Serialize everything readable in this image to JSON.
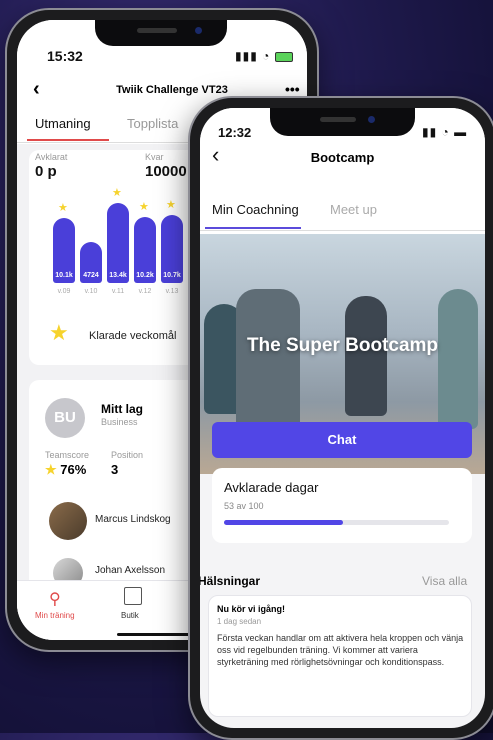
{
  "back_phone": {
    "time": "15:32",
    "title": "Twiik Challenge VT23",
    "tabs": [
      "Utmaning",
      "Topplista"
    ],
    "stats": {
      "done_label": "Avklarat",
      "done_value": "0 p",
      "left_label": "Kvar",
      "left_value": "10000 p"
    },
    "bars": [
      {
        "label": "v.09",
        "value": "10.1k",
        "star": true
      },
      {
        "label": "v.10",
        "value": "4724",
        "star": false
      },
      {
        "label": "v.11",
        "value": "13.4k",
        "star": true
      },
      {
        "label": "v.12",
        "value": "10.2k",
        "star": true
      },
      {
        "label": "v.13",
        "value": "10.7k",
        "star": true
      }
    ],
    "weekly_goals": "Klarade veckomål",
    "team": {
      "initials": "BU",
      "name": "Mitt lag",
      "type": "Business",
      "score_label": "Teamscore",
      "score": "76%",
      "position_label": "Position",
      "position": "3"
    },
    "members": [
      "Marcus Lindskog",
      "Johan Axelsson"
    ],
    "bottom_nav": [
      "Min träning",
      "Butik"
    ]
  },
  "front_phone": {
    "time": "12:32",
    "title": "Bootcamp",
    "tabs": [
      "Min Coachning",
      "Meet up"
    ],
    "hero_title": "The Super Bootcamp",
    "chat_label": "Chat",
    "progress": {
      "title": "Avklarade dagar",
      "subtitle": "53 av 100",
      "done": 53,
      "total": 100
    },
    "greetings": {
      "header": "Hälsningar",
      "see_all": "Visa alla",
      "item_title": "Nu kör vi igång!",
      "item_time": "1 dag sedan",
      "item_body": "Första veckan handlar om att aktivera hela kroppen och vänja oss vid regelbunden träning. Vi kommer att variera styrketräning med rörlighetsövningar och konditionspass."
    }
  },
  "colors": {
    "accent": "#5146e6",
    "star": "#f6d32d",
    "active_tab_back": "#e04a4a"
  }
}
